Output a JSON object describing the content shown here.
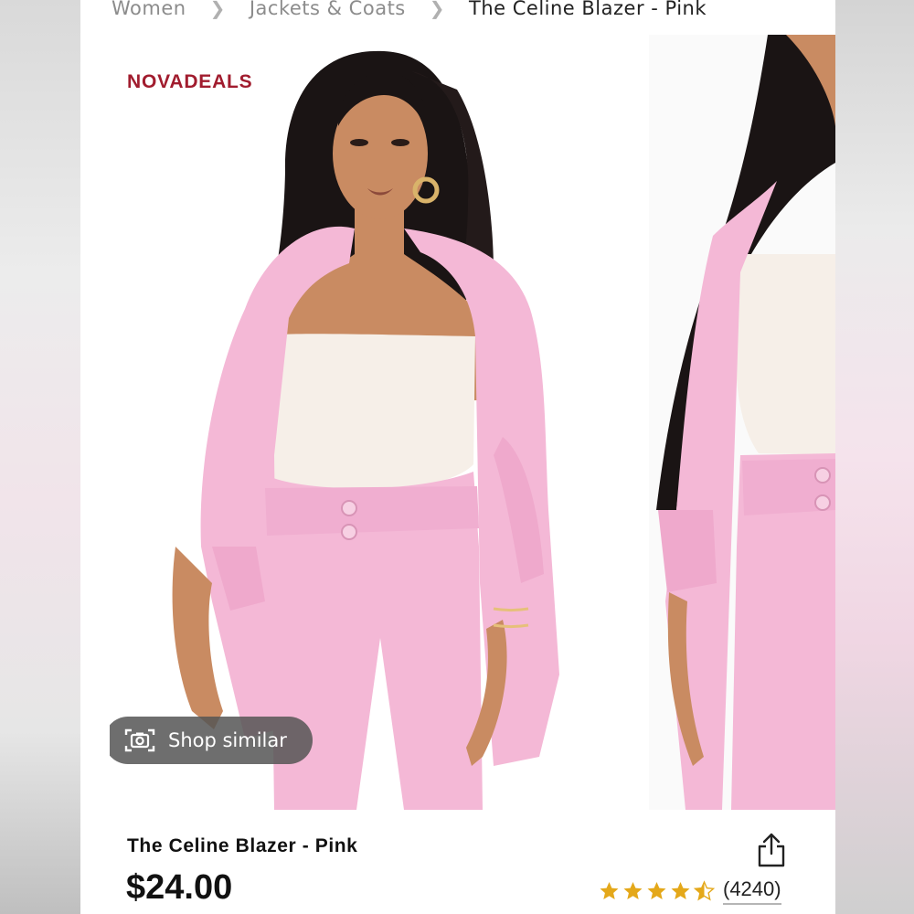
{
  "breadcrumb": {
    "items": [
      "Women",
      "Jackets & Coats",
      "The Celine Blazer - Pink"
    ]
  },
  "gallery": {
    "promo_badge": "NOVADEALS",
    "shop_similar_label": "Shop similar",
    "shop_similar_icon": "camera-scan-icon"
  },
  "product": {
    "title": "The Celine Blazer - Pink",
    "price": "$24.00",
    "rating": 4.5,
    "review_count": "(4240)",
    "share_icon": "share-icon"
  },
  "colors": {
    "promo_badge": "#a11c2e",
    "star": "#e4a81a",
    "blazer_pink": "#f4b8d6",
    "top_white": "#f6efe8"
  }
}
